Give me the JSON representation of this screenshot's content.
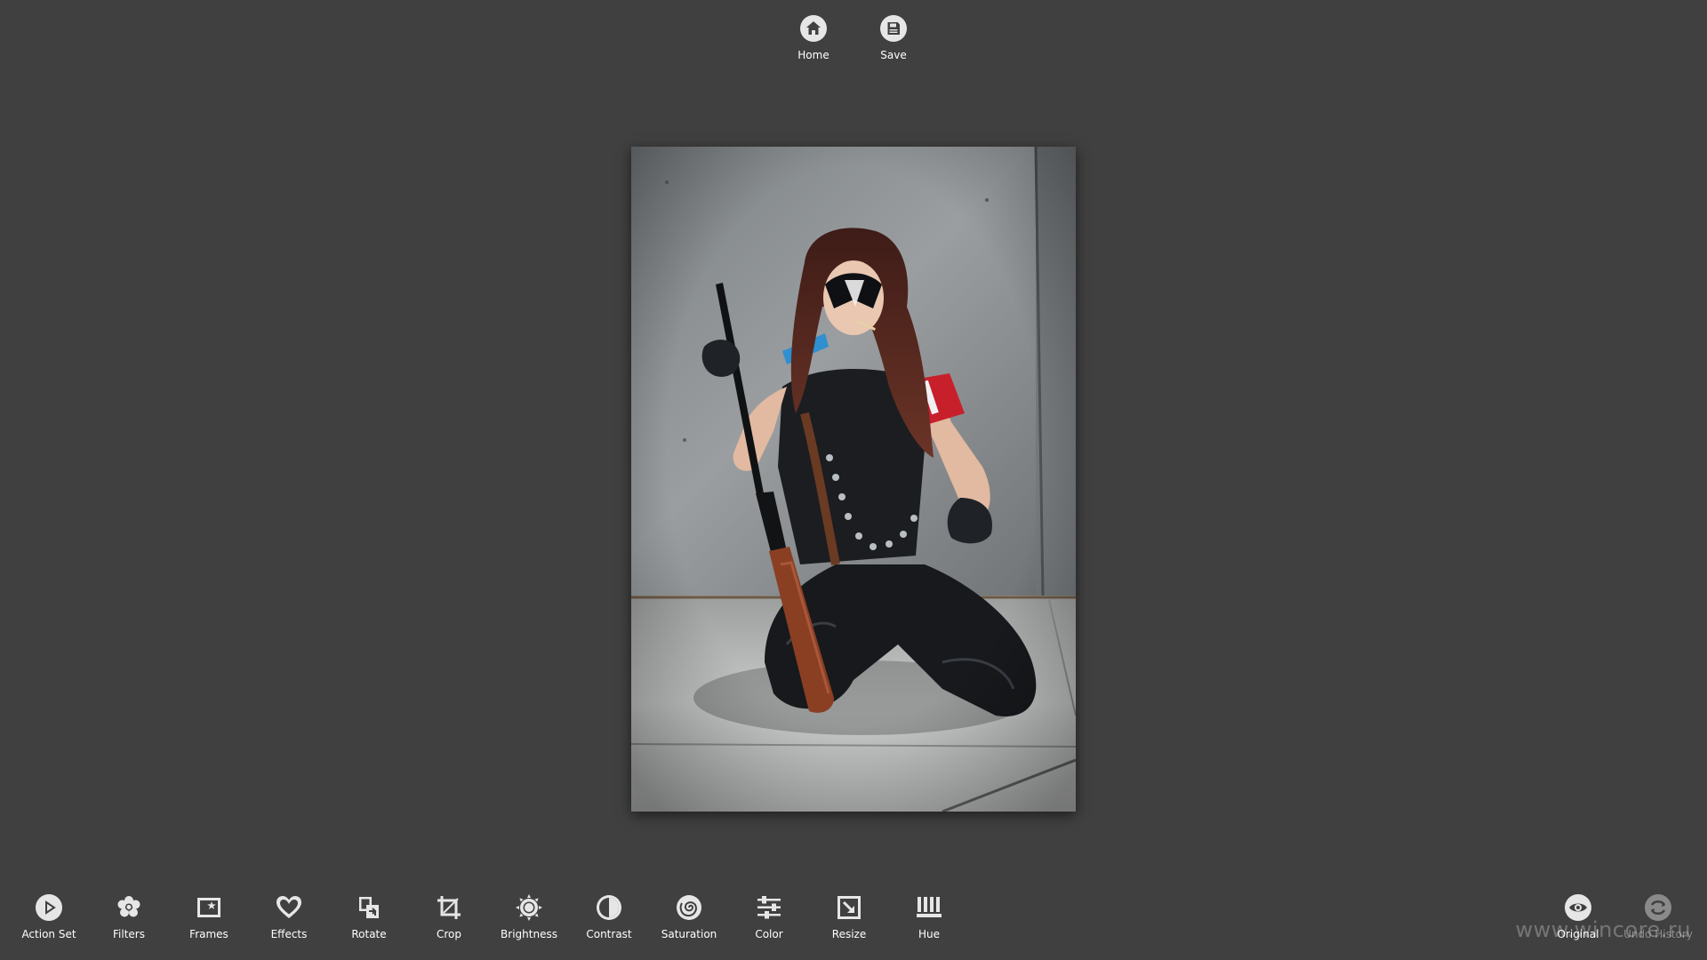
{
  "app_bar": {
    "home_label": "Home",
    "save_label": "Save",
    "home_icon": "home-icon",
    "save_icon": "floppy-disk-icon"
  },
  "photo": {
    "subject": "cosplay-portrait",
    "palette": {
      "wall": "#8f9396",
      "floor": "#c4c6c5",
      "leather": "#15171a",
      "hair": "#5a2a22",
      "stock": "#8a3f22",
      "arm_band": "#c8202b",
      "shoulder_blue": "#2f8fd0"
    }
  },
  "toolbar": {
    "tools": [
      {
        "label": "Action Set",
        "icon": "play-icon"
      },
      {
        "label": "Filters",
        "icon": "flower-icon"
      },
      {
        "label": "Frames",
        "icon": "frame-star-icon"
      },
      {
        "label": "Effects",
        "icon": "heart-icon"
      },
      {
        "label": "Rotate",
        "icon": "rotate-icon"
      },
      {
        "label": "Crop",
        "icon": "crop-icon"
      },
      {
        "label": "Brightness",
        "icon": "sun-icon"
      },
      {
        "label": "Contrast",
        "icon": "contrast-icon"
      },
      {
        "label": "Saturation",
        "icon": "spiral-icon"
      },
      {
        "label": "Color",
        "icon": "sliders-icon"
      },
      {
        "label": "Resize",
        "icon": "resize-icon"
      },
      {
        "label": "Hue",
        "icon": "bars-icon"
      }
    ],
    "original_label": "Original",
    "undo_history_label": "Undo History",
    "original_icon": "eye-icon",
    "undo_icon": "history-icon"
  },
  "watermark": "www.wincore.ru",
  "colors": {
    "background": "#404040",
    "icon_fill": "#ffffff",
    "label": "#ffffff",
    "disabled_label": "#8a8a8a"
  }
}
